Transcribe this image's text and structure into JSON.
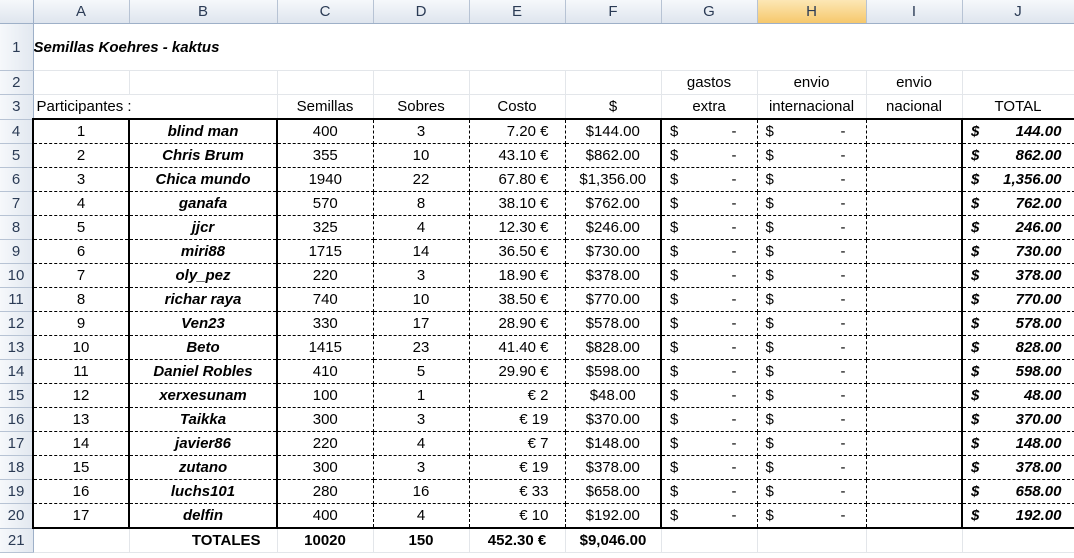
{
  "columns": [
    "A",
    "B",
    "C",
    "D",
    "E",
    "F",
    "G",
    "H",
    "I",
    "J"
  ],
  "selected_column": "H",
  "title": "Semillas Koehres - kaktus",
  "header_row2": {
    "G": "gastos",
    "H": "envio",
    "I": "envio"
  },
  "header_row3": {
    "A": "Participantes :",
    "C": "Semillas",
    "D": "Sobres",
    "E": "Costo",
    "F": "$",
    "G": "extra",
    "H": "internacional",
    "I": "nacional",
    "J": "TOTAL"
  },
  "dash_currency": "$",
  "dash_value": "-",
  "rows": [
    {
      "n": "1",
      "name": "blind man",
      "semillas": "400",
      "sobres": "3",
      "costo": "7.20 €",
      "usd": "$144.00",
      "total_sym": "$",
      "total": "144.00"
    },
    {
      "n": "2",
      "name": "Chris Brum",
      "semillas": "355",
      "sobres": "10",
      "costo": "43.10 €",
      "usd": "$862.00",
      "total_sym": "$",
      "total": "862.00"
    },
    {
      "n": "3",
      "name": "Chica mundo",
      "semillas": "1940",
      "sobres": "22",
      "costo": "67.80 €",
      "usd": "$1,356.00",
      "total_sym": "$",
      "total": "1,356.00"
    },
    {
      "n": "4",
      "name": "ganafa",
      "semillas": "570",
      "sobres": "8",
      "costo": "38.10 €",
      "usd": "$762.00",
      "total_sym": "$",
      "total": "762.00"
    },
    {
      "n": "5",
      "name": "jjcr",
      "semillas": "325",
      "sobres": "4",
      "costo": "12.30 €",
      "usd": "$246.00",
      "total_sym": "$",
      "total": "246.00"
    },
    {
      "n": "6",
      "name": "miri88",
      "semillas": "1715",
      "sobres": "14",
      "costo": "36.50 €",
      "usd": "$730.00",
      "total_sym": "$",
      "total": "730.00"
    },
    {
      "n": "7",
      "name": "oly_pez",
      "semillas": "220",
      "sobres": "3",
      "costo": "18.90 €",
      "usd": "$378.00",
      "total_sym": "$",
      "total": "378.00"
    },
    {
      "n": "8",
      "name": "richar raya",
      "semillas": "740",
      "sobres": "10",
      "costo": "38.50 €",
      "usd": "$770.00",
      "total_sym": "$",
      "total": "770.00"
    },
    {
      "n": "9",
      "name": "Ven23",
      "semillas": "330",
      "sobres": "17",
      "costo": "28.90 €",
      "usd": "$578.00",
      "total_sym": "$",
      "total": "578.00"
    },
    {
      "n": "10",
      "name": "Beto",
      "semillas": "1415",
      "sobres": "23",
      "costo": "41.40 €",
      "usd": "$828.00",
      "total_sym": "$",
      "total": "828.00"
    },
    {
      "n": "11",
      "name": "Daniel Robles",
      "semillas": "410",
      "sobres": "5",
      "costo": "29.90 €",
      "usd": "$598.00",
      "total_sym": "$",
      "total": "598.00"
    },
    {
      "n": "12",
      "name": "xerxesunam",
      "semillas": "100",
      "sobres": "1",
      "costo": "€ 2",
      "usd": "$48.00",
      "total_sym": "$",
      "total": "48.00"
    },
    {
      "n": "13",
      "name": "Taikka",
      "semillas": "300",
      "sobres": "3",
      "costo": "€ 19",
      "usd": "$370.00",
      "total_sym": "$",
      "total": "370.00"
    },
    {
      "n": "14",
      "name": "javier86",
      "semillas": "220",
      "sobres": "4",
      "costo": "€ 7",
      "usd": "$148.00",
      "total_sym": "$",
      "total": "148.00"
    },
    {
      "n": "15",
      "name": "zutano",
      "semillas": "300",
      "sobres": "3",
      "costo": "€ 19",
      "usd": "$378.00",
      "total_sym": "$",
      "total": "378.00"
    },
    {
      "n": "16",
      "name": "luchs101",
      "semillas": "280",
      "sobres": "16",
      "costo": "€ 33",
      "usd": "$658.00",
      "total_sym": "$",
      "total": "658.00"
    },
    {
      "n": "17",
      "name": "delfin",
      "semillas": "400",
      "sobres": "4",
      "costo": "€ 10",
      "usd": "$192.00",
      "total_sym": "$",
      "total": "192.00"
    }
  ],
  "totals": {
    "label": "TOTALES",
    "semillas": "10020",
    "sobres": "150",
    "costo": "452.30 €",
    "usd": "$9,046.00"
  },
  "colors": {
    "title_red": "#e30d0d",
    "name_navy": "#1f2a52",
    "selected_header": "#f6c86c"
  }
}
